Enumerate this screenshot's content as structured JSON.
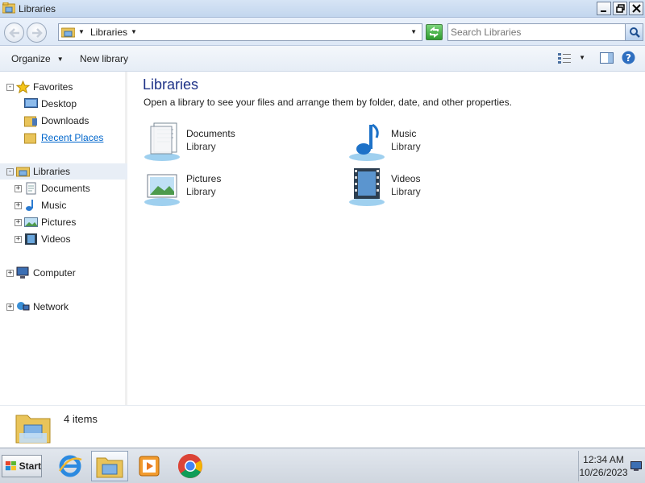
{
  "window": {
    "title": "Libraries"
  },
  "address": {
    "crumb": "Libraries",
    "search_placeholder": "Search Libraries"
  },
  "toolbar": {
    "organize": "Organize",
    "new_library": "New library"
  },
  "nav": {
    "favorites": {
      "label": "Favorites",
      "items": [
        {
          "label": "Desktop"
        },
        {
          "label": "Downloads"
        },
        {
          "label": "Recent Places"
        }
      ]
    },
    "libraries": {
      "label": "Libraries",
      "items": [
        {
          "label": "Documents"
        },
        {
          "label": "Music"
        },
        {
          "label": "Pictures"
        },
        {
          "label": "Videos"
        }
      ]
    },
    "computer": {
      "label": "Computer"
    },
    "network": {
      "label": "Network"
    }
  },
  "content": {
    "heading": "Libraries",
    "subtitle": "Open a library to see your files and arrange them by folder, date, and other properties.",
    "libraries": [
      {
        "name": "Documents",
        "type": "Library",
        "icon": "documents-library-icon"
      },
      {
        "name": "Music",
        "type": "Library",
        "icon": "music-library-icon"
      },
      {
        "name": "Pictures",
        "type": "Library",
        "icon": "pictures-library-icon"
      },
      {
        "name": "Videos",
        "type": "Library",
        "icon": "videos-library-icon"
      }
    ]
  },
  "details": {
    "count": "4 items"
  },
  "taskbar": {
    "start": "Start",
    "apps": [
      "internet-explorer-icon",
      "windows-explorer-icon",
      "media-player-icon",
      "chrome-icon"
    ],
    "time": "12:34 AM",
    "date": "10/26/2023"
  },
  "colors": {
    "heading": "#1e3287",
    "link": "#0066cc",
    "selection": "#e8eef6"
  }
}
